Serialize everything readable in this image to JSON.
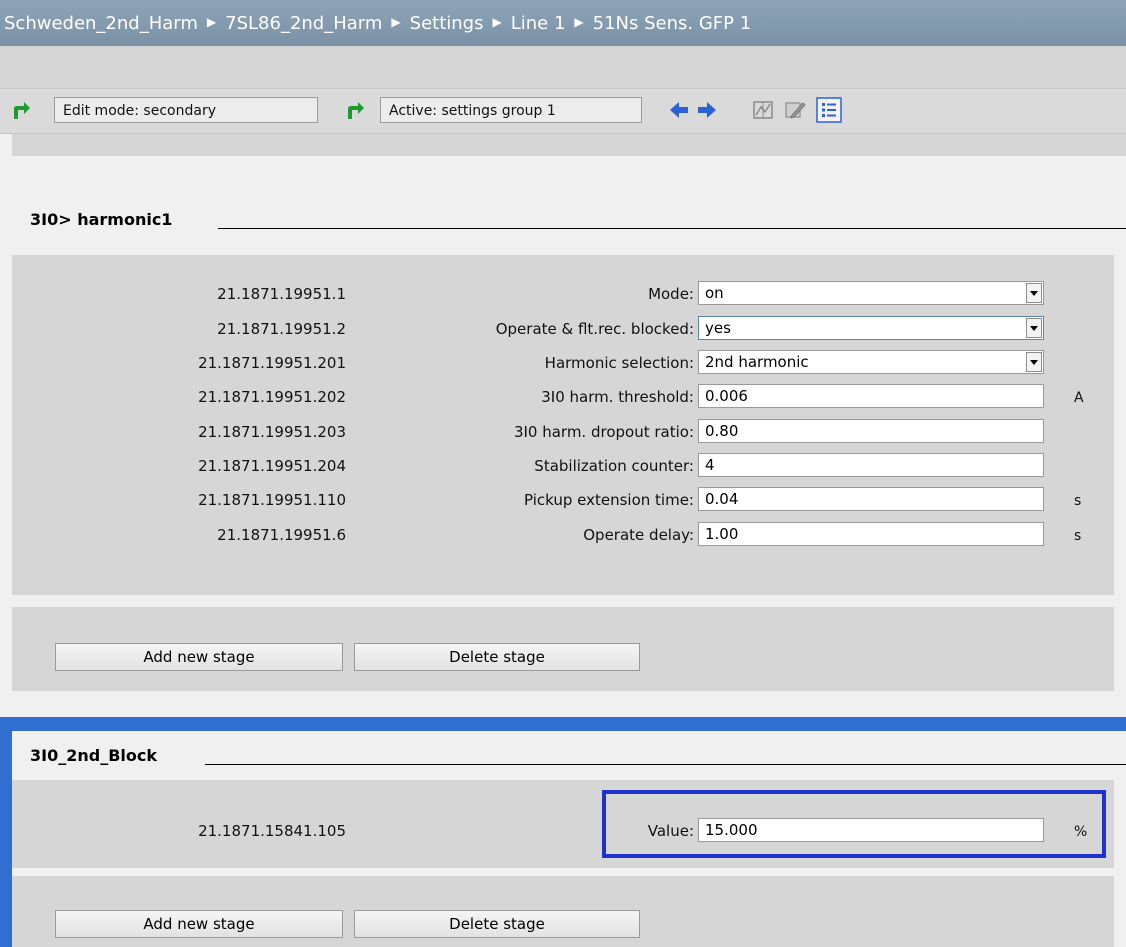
{
  "breadcrumb": [
    "Schweden_2nd_Harm",
    "7SL86_2nd_Harm",
    "Settings",
    "Line 1",
    "51Ns Sens. GFP 1"
  ],
  "toolbar": {
    "edit_mode": "Edit mode: secondary",
    "active_group": "Active: settings group 1"
  },
  "section1": {
    "title": "3I0> harmonic1",
    "rows": [
      {
        "addr": "21.1871.19951.1",
        "label": "Mode:",
        "value": "on",
        "type": "dropdown",
        "unit": ""
      },
      {
        "addr": "21.1871.19951.2",
        "label": "Operate & flt.rec. blocked:",
        "value": "yes",
        "type": "dropdown",
        "unit": ""
      },
      {
        "addr": "21.1871.19951.201",
        "label": "Harmonic selection:",
        "value": "2nd harmonic",
        "type": "dropdown",
        "unit": ""
      },
      {
        "addr": "21.1871.19951.202",
        "label": "3I0 harm. threshold:",
        "value": "0.006",
        "type": "text",
        "unit": "A"
      },
      {
        "addr": "21.1871.19951.203",
        "label": "3I0 harm. dropout ratio:",
        "value": "0.80",
        "type": "text",
        "unit": ""
      },
      {
        "addr": "21.1871.19951.204",
        "label": "Stabilization counter:",
        "value": "4",
        "type": "text",
        "unit": ""
      },
      {
        "addr": "21.1871.19951.110",
        "label": "Pickup extension time:",
        "value": "0.04",
        "type": "text",
        "unit": "s"
      },
      {
        "addr": "21.1871.19951.6",
        "label": "Operate delay:",
        "value": "1.00",
        "type": "text",
        "unit": "s"
      }
    ],
    "add_label": "Add new stage",
    "delete_label": "Delete stage"
  },
  "section2": {
    "title": "3I0_2nd_Block",
    "rows": [
      {
        "addr": "21.1871.15841.105",
        "label": "Value:",
        "value": "15.000",
        "type": "text",
        "unit": "%"
      }
    ],
    "add_label": "Add new stage",
    "delete_label": "Delete stage"
  },
  "colors": {
    "title_bar": "#7f95aa",
    "panel": "#d6d6d6",
    "selection_blue": "#2f6fd1",
    "highlight": "#1d33cc"
  }
}
